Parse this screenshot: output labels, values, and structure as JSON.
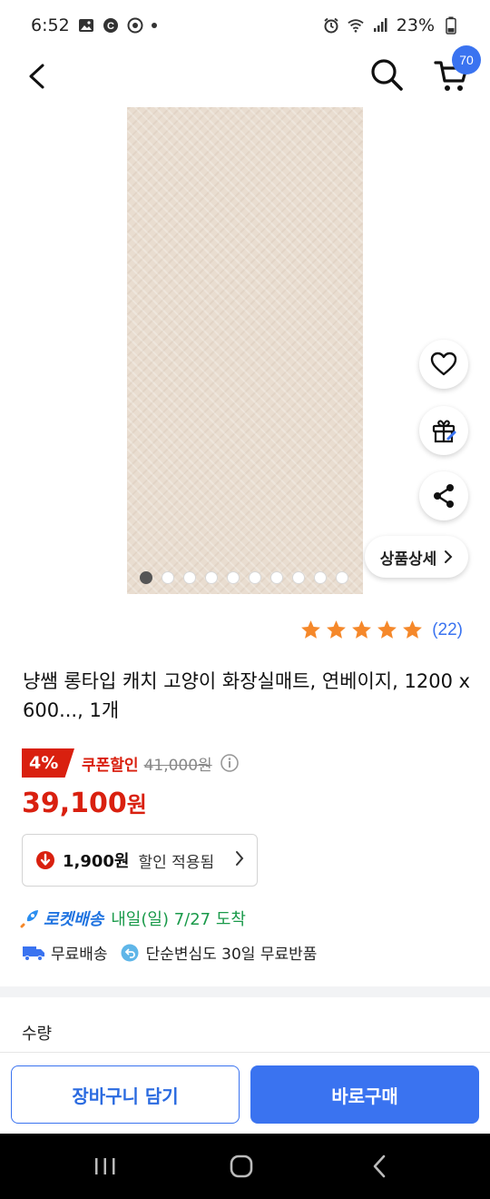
{
  "status_bar": {
    "time": "6:52",
    "battery": "23%"
  },
  "header": {
    "cart_count": "70"
  },
  "gallery": {
    "total_images": 10,
    "current_index": 0
  },
  "detail_button": {
    "label": "상품상세"
  },
  "rating": {
    "stars": 5,
    "review_count": "(22)"
  },
  "product": {
    "title": "냥쌤 롱타입 캐치 고양이 화장실매트, 연베이지, 1200 x 600..., 1개",
    "discount_percent": "4%",
    "coupon_label": "쿠폰할인",
    "original_price": "41,000원",
    "price_number": "39,100",
    "price_unit": "원"
  },
  "discount_box": {
    "amount": "1,900원",
    "text": "할인 적용됨"
  },
  "delivery": {
    "rocket_label": "로켓배송",
    "arrival": "내일(일) 7/27 도착",
    "free_shipping": "무료배송",
    "free_return": "단순변심도 30일 무료반품"
  },
  "quantity": {
    "label": "수량"
  },
  "actions": {
    "add_to_cart": "장바구니 담기",
    "buy_now": "바로구매"
  },
  "colors": {
    "accent_blue": "#3a73f0",
    "price_red": "#d9200f",
    "star_orange": "#f5882a",
    "arrival_green": "#1a9a4a"
  }
}
